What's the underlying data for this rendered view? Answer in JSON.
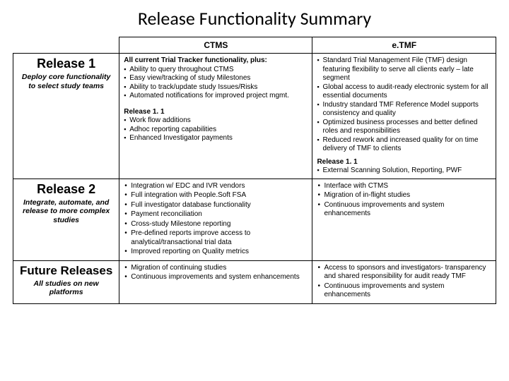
{
  "title": "Release Functionality Summary",
  "columns": {
    "blank": "",
    "ctms": "CTMS",
    "etmf": "e.TMF"
  },
  "rows": [
    {
      "name": "Release 1",
      "sub": "Deploy core functionality to select study teams",
      "ctms": {
        "lead": "All current Trial Tracker functionality, plus:",
        "bullets": [
          "Ability to query throughout CTMS",
          "Easy view/tracking of study Milestones",
          "Ability to track/update study Issues/Risks",
          "Automated notifications for improved project mgmt."
        ],
        "sub_heading": "Release 1. 1",
        "sub_bullets": [
          "Work flow additions",
          "Adhoc reporting capabilities",
          "Enhanced Investigator payments"
        ]
      },
      "etmf": {
        "bullets": [
          "Standard Trial Management File (TMF) design featuring flexibility to serve all clients early – late segment",
          "Global access to audit-ready electronic system for all essential documents",
          "Industry standard TMF Reference Model supports consistency and quality",
          "Optimized business processes and better defined roles and responsibilities",
          "Reduced rework and increased quality for on time delivery of TMF to clients"
        ],
        "sub_heading": "Release 1. 1",
        "sub_bullets": [
          "External Scanning Solution, Reporting, PWF"
        ]
      }
    },
    {
      "name": "Release 2",
      "sub": "Integrate, automate, and release to more complex studies",
      "ctms": {
        "dots": [
          "Integration w/ EDC and IVR vendors",
          "Full integration with People.Soft FSA",
          "Full investigator database functionality",
          "Payment reconciliation",
          "Cross-study Milestone reporting",
          "Pre-defined reports improve access to analytical/transactional trial data",
          "Improved reporting on Quality metrics"
        ]
      },
      "etmf": {
        "dots": [
          "Interface with CTMS",
          "Migration of in-flight studies",
          "Continuous improvements and system enhancements"
        ]
      }
    },
    {
      "name": "Future Releases",
      "sub": "All studies on new platforms",
      "ctms": {
        "dots": [
          "Migration of continuing studies",
          "Continuous improvements and system enhancements"
        ]
      },
      "etmf": {
        "dots": [
          "Access to sponsors and investigators- transparency and shared responsibility for audit ready TMF",
          "Continuous improvements and system enhancements"
        ]
      }
    }
  ]
}
